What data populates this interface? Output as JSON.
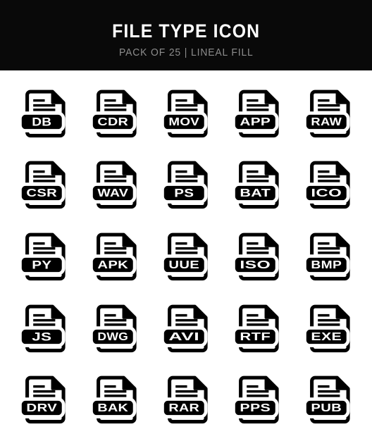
{
  "header": {
    "title": "FILE TYPE ICON",
    "subtitle": "PACK OF 25 | LINEAL FILL",
    "background_color": "#090909",
    "title_color": "#ffffff",
    "subtitle_color": "#8d8d8d"
  },
  "grid": {
    "columns": 5,
    "rows": 5,
    "total_icons": 25,
    "icon_style": "lineal fill",
    "icon_fill_color": "#000000",
    "icon_paper_color": "#ffffff",
    "badge_text_color": "#ffffff"
  },
  "icons": [
    {
      "label": "DB",
      "name": "file-type-icon-db"
    },
    {
      "label": "CDR",
      "name": "file-type-icon-cdr"
    },
    {
      "label": "MOV",
      "name": "file-type-icon-mov"
    },
    {
      "label": "APP",
      "name": "file-type-icon-app"
    },
    {
      "label": "RAW",
      "name": "file-type-icon-raw"
    },
    {
      "label": "CSR",
      "name": "file-type-icon-csr"
    },
    {
      "label": "WAV",
      "name": "file-type-icon-wav"
    },
    {
      "label": "PS",
      "name": "file-type-icon-ps"
    },
    {
      "label": "BAT",
      "name": "file-type-icon-bat"
    },
    {
      "label": "ICO",
      "name": "file-type-icon-ico"
    },
    {
      "label": "PY",
      "name": "file-type-icon-py"
    },
    {
      "label": "APK",
      "name": "file-type-icon-apk"
    },
    {
      "label": "UUE",
      "name": "file-type-icon-uue"
    },
    {
      "label": "ISO",
      "name": "file-type-icon-iso"
    },
    {
      "label": "BMP",
      "name": "file-type-icon-bmp"
    },
    {
      "label": "JS",
      "name": "file-type-icon-js"
    },
    {
      "label": "DWG",
      "name": "file-type-icon-dwg"
    },
    {
      "label": "AVI",
      "name": "file-type-icon-avi"
    },
    {
      "label": "RTF",
      "name": "file-type-icon-rtf"
    },
    {
      "label": "EXE",
      "name": "file-type-icon-exe"
    },
    {
      "label": "DRV",
      "name": "file-type-icon-drv"
    },
    {
      "label": "BAK",
      "name": "file-type-icon-bak"
    },
    {
      "label": "RAR",
      "name": "file-type-icon-rar"
    },
    {
      "label": "PPS",
      "name": "file-type-icon-pps"
    },
    {
      "label": "PUB",
      "name": "file-type-icon-pub"
    }
  ]
}
